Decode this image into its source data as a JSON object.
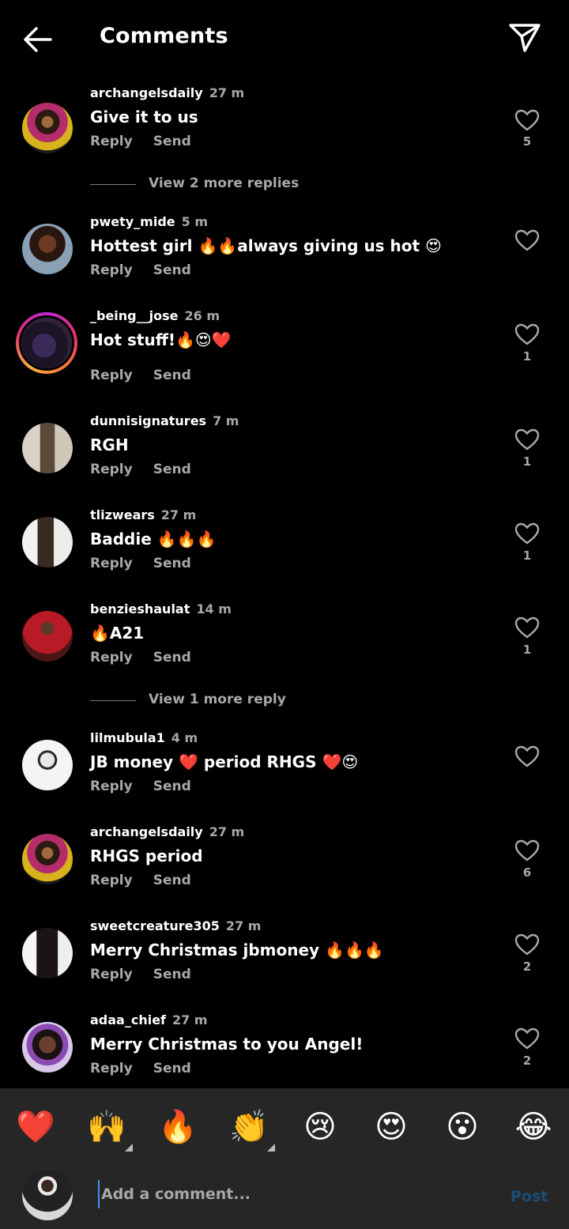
{
  "header": {
    "title": "Comments",
    "back_icon": "arrow-left-icon",
    "share_icon": "paper-plane-icon"
  },
  "comments": [
    {
      "username": "archangelsdaily",
      "time": "27 m",
      "text": "Give it to us",
      "reply": "Reply",
      "send": "Send",
      "likes": "5"
    },
    {
      "username": "pwety_mide",
      "time": "5 m",
      "text": "Hottest girl 🔥🔥always giving us hot 😍",
      "reply": "Reply",
      "send": "Send",
      "likes": ""
    },
    {
      "username": "_being__jose",
      "time": "26 m",
      "text": "Hot stuff!🔥😍❤️",
      "reply": "Reply",
      "send": "Send",
      "likes": "1"
    },
    {
      "username": "dunnisignatures",
      "time": "7 m",
      "text": "RGH",
      "reply": "Reply",
      "send": "Send",
      "likes": "1"
    },
    {
      "username": "tlizwears",
      "time": "27 m",
      "text": "Baddie 🔥🔥🔥",
      "reply": "Reply",
      "send": "Send",
      "likes": "1"
    },
    {
      "username": "benzieshaulat",
      "time": "14 m",
      "text": "🔥A21",
      "reply": "Reply",
      "send": "Send",
      "likes": "1"
    },
    {
      "username": "lilmubula1",
      "time": "4 m",
      "text": "JB money ❤️ period RHGS ❤️😍",
      "reply": "Reply",
      "send": "Send",
      "likes": ""
    },
    {
      "username": "archangelsdaily",
      "time": "27 m",
      "text": "RHGS period",
      "reply": "Reply",
      "send": "Send",
      "likes": "6"
    },
    {
      "username": "sweetcreature305",
      "time": "27 m",
      "text": "Merry Christmas jbmoney 🔥🔥🔥",
      "reply": "Reply",
      "send": "Send",
      "likes": "2"
    },
    {
      "username": "adaa_chief",
      "time": "27 m",
      "text": "Merry Christmas to you Angel!",
      "reply": "Reply",
      "send": "Send",
      "likes": "2"
    }
  ],
  "view_more": [
    "View 2 more replies",
    "View 1 more reply"
  ],
  "emoji_bar": [
    "❤️",
    "🙌",
    "🔥",
    "👏",
    "😢",
    "😍",
    "😮",
    "😂"
  ],
  "composer": {
    "placeholder": "Add a comment...",
    "post_label": "Post"
  },
  "colors": {
    "background": "#000000",
    "secondary_text": "#a8a8a8",
    "emoji_bar_bg": "#262626",
    "post_disabled": "#1e4c7a"
  }
}
